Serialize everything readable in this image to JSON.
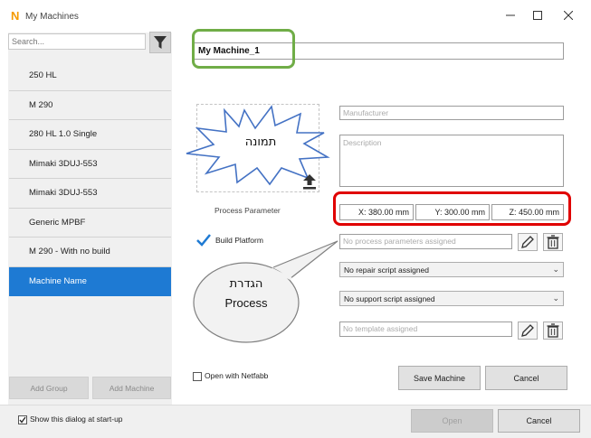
{
  "window": {
    "title": "My Machines",
    "logo": "N",
    "minimize_icon": "minimize-icon",
    "maximize_icon": "maximize-icon",
    "close_icon": "close-icon"
  },
  "sidebar": {
    "search_placeholder": "Search...",
    "filter_icon": "filter-icon",
    "items": [
      {
        "label": "250 HL"
      },
      {
        "label": "M 290"
      },
      {
        "label": "280 HL 1.0 Single"
      },
      {
        "label": "Mimaki 3DUJ-553"
      },
      {
        "label": "Mimaki 3DUJ-553"
      },
      {
        "label": "Generic MPBF"
      },
      {
        "label": "M 290 - With no build"
      },
      {
        "label": "Machine Name"
      }
    ],
    "selected_index": 7,
    "add_group_label": "Add Group",
    "add_machine_label": "Add Machine"
  },
  "form": {
    "machine_name": "My Machine_1",
    "manufacturer_placeholder": "Manufacturer",
    "description_placeholder": "Description",
    "image_callout_text": "תמונה",
    "upload_icon": "upload-icon",
    "process_parameter_label": "Process Parameter",
    "dimensions": {
      "x": "X: 380.00 mm",
      "y": "Y: 300.00 mm",
      "z": "Z: 450.00 mm"
    },
    "build_platform_label": "Build Platform",
    "process_parameters_placeholder": "No process parameters assigned",
    "repair_script": "No repair script assigned",
    "support_script": "No support script assigned",
    "template_placeholder": "No template assigned",
    "process_callout_line1": "הגדרת",
    "process_callout_line2": "Process",
    "open_with_netfabb_label": "Open with Netfabb",
    "save_machine_label": "Save Machine",
    "cancel_label": "Cancel",
    "edit_icon": "pencil-icon",
    "delete_icon": "trash-icon"
  },
  "footer": {
    "show_dialog_label": "Show this dialog at start-up",
    "show_dialog_checked": true,
    "open_label": "Open",
    "cancel_label": "Cancel"
  },
  "colors": {
    "selected_item": "#1e7ad3",
    "name_highlight": "#70ad47",
    "dims_highlight": "#e00000",
    "callout_border": "#4472c4",
    "checkmark": "#1e7ad3"
  }
}
